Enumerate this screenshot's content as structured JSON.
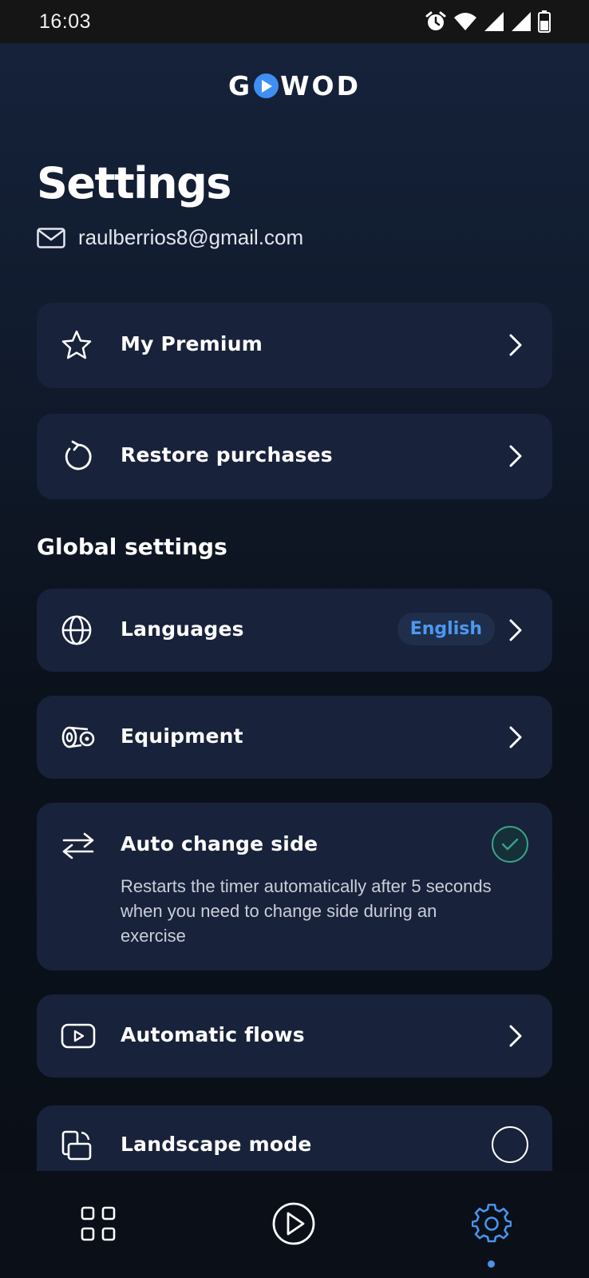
{
  "status_bar": {
    "time": "16:03",
    "icons": [
      "alarm-icon",
      "wifi-icon",
      "signal-icon",
      "signal-icon",
      "battery-icon"
    ]
  },
  "header": {
    "logo": {
      "left": "G",
      "right": "WOD"
    }
  },
  "page": {
    "title": "Settings",
    "email": "raulberrios8@gmail.com"
  },
  "account_items": [
    {
      "label": "My Premium",
      "icon": "star-icon"
    },
    {
      "label": "Restore purchases",
      "icon": "restore-icon"
    }
  ],
  "global_settings": {
    "title": "Global settings",
    "languages": {
      "label": "Languages",
      "value": "English",
      "icon": "globe-icon"
    },
    "equipment": {
      "label": "Equipment",
      "icon": "equipment-icon"
    },
    "auto_change_side": {
      "label": "Auto change side",
      "description": "Restarts the timer automatically after 5 seconds when you need to change side during an exercise",
      "checked": true,
      "icon": "swap-arrows-icon"
    },
    "automatic_flows": {
      "label": "Automatic flows",
      "icon": "play-box-icon"
    },
    "landscape_mode": {
      "label": "Landscape mode",
      "checked": false,
      "icon": "rotate-screen-icon"
    }
  },
  "bottom_nav": {
    "items": [
      "grid-icon",
      "play-icon",
      "gear-icon"
    ],
    "active": "gear-icon"
  },
  "colors": {
    "accent": "#3f8ef2",
    "card": "#18223a",
    "check": "#3aa287"
  }
}
